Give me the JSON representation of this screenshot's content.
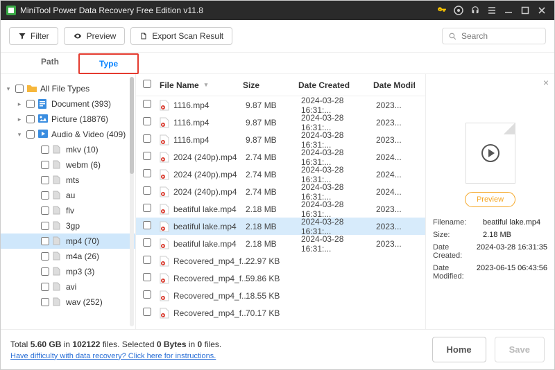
{
  "titlebar": {
    "title": "MiniTool Power Data Recovery Free Edition v11.8"
  },
  "toolbar": {
    "filter_label": "Filter",
    "preview_label": "Preview",
    "export_label": "Export Scan Result",
    "search_placeholder": "Search"
  },
  "tabs": {
    "path": "Path",
    "type": "Type"
  },
  "sidebar": {
    "root_label": "All File Types",
    "document_label": "Document (393)",
    "picture_label": "Picture (18876)",
    "av_label": "Audio & Video (409)",
    "items": [
      {
        "label": "mkv (10)"
      },
      {
        "label": "webm (6)"
      },
      {
        "label": "mts"
      },
      {
        "label": "au"
      },
      {
        "label": "flv"
      },
      {
        "label": "3gp"
      },
      {
        "label": "mp4 (70)"
      },
      {
        "label": "m4a (26)"
      },
      {
        "label": "mp3 (3)"
      },
      {
        "label": "avi"
      },
      {
        "label": "wav (252)"
      }
    ]
  },
  "columns": {
    "name": "File Name",
    "size": "Size",
    "created": "Date Created",
    "modified": "Date Modif"
  },
  "rows": [
    {
      "name": "1116.mp4",
      "size": "9.87 MB",
      "created": "2024-03-28 16:31:...",
      "modified": "2023..."
    },
    {
      "name": "1116.mp4",
      "size": "9.87 MB",
      "created": "2024-03-28 16:31:...",
      "modified": "2023..."
    },
    {
      "name": "1116.mp4",
      "size": "9.87 MB",
      "created": "2024-03-28 16:31:...",
      "modified": "2023..."
    },
    {
      "name": "2024 (240p).mp4",
      "size": "2.74 MB",
      "created": "2024-03-28 16:31:...",
      "modified": "2024..."
    },
    {
      "name": "2024 (240p).mp4",
      "size": "2.74 MB",
      "created": "2024-03-28 16:31:...",
      "modified": "2024..."
    },
    {
      "name": "2024 (240p).mp4",
      "size": "2.74 MB",
      "created": "2024-03-28 16:31:...",
      "modified": "2024..."
    },
    {
      "name": "beatiful lake.mp4",
      "size": "2.18 MB",
      "created": "2024-03-28 16:31:...",
      "modified": "2023..."
    },
    {
      "name": "beatiful lake.mp4",
      "size": "2.18 MB",
      "created": "2024-03-28 16:31:...",
      "modified": "2023..."
    },
    {
      "name": "beatiful lake.mp4",
      "size": "2.18 MB",
      "created": "2024-03-28 16:31:...",
      "modified": "2023..."
    },
    {
      "name": "Recovered_mp4_f...",
      "size": "22.97 KB",
      "created": "",
      "modified": ""
    },
    {
      "name": "Recovered_mp4_f...",
      "size": "59.86 KB",
      "created": "",
      "modified": ""
    },
    {
      "name": "Recovered_mp4_f...",
      "size": "18.55 KB",
      "created": "",
      "modified": ""
    },
    {
      "name": "Recovered_mp4_f...",
      "size": "70.17 KB",
      "created": "",
      "modified": ""
    }
  ],
  "preview": {
    "btn": "Preview",
    "filename_label": "Filename:",
    "filename": "beatiful lake.mp4",
    "size_label": "Size:",
    "size": "2.18 MB",
    "created_label": "Date Created:",
    "created": "2024-03-28 16:31:35",
    "modified_label": "Date Modified:",
    "modified": "2023-06-15 06:43:56"
  },
  "status": {
    "total_prefix": "Total ",
    "total_size": "5.60 GB",
    "total_mid": " in ",
    "total_files": "102122",
    "total_suffix": " files.  Selected ",
    "sel_bytes": "0 Bytes",
    "sel_mid": " in ",
    "sel_files": "0",
    "sel_suffix": " files.",
    "help_link": "Have difficulty with data recovery? Click here for instructions.",
    "home": "Home",
    "save": "Save"
  }
}
